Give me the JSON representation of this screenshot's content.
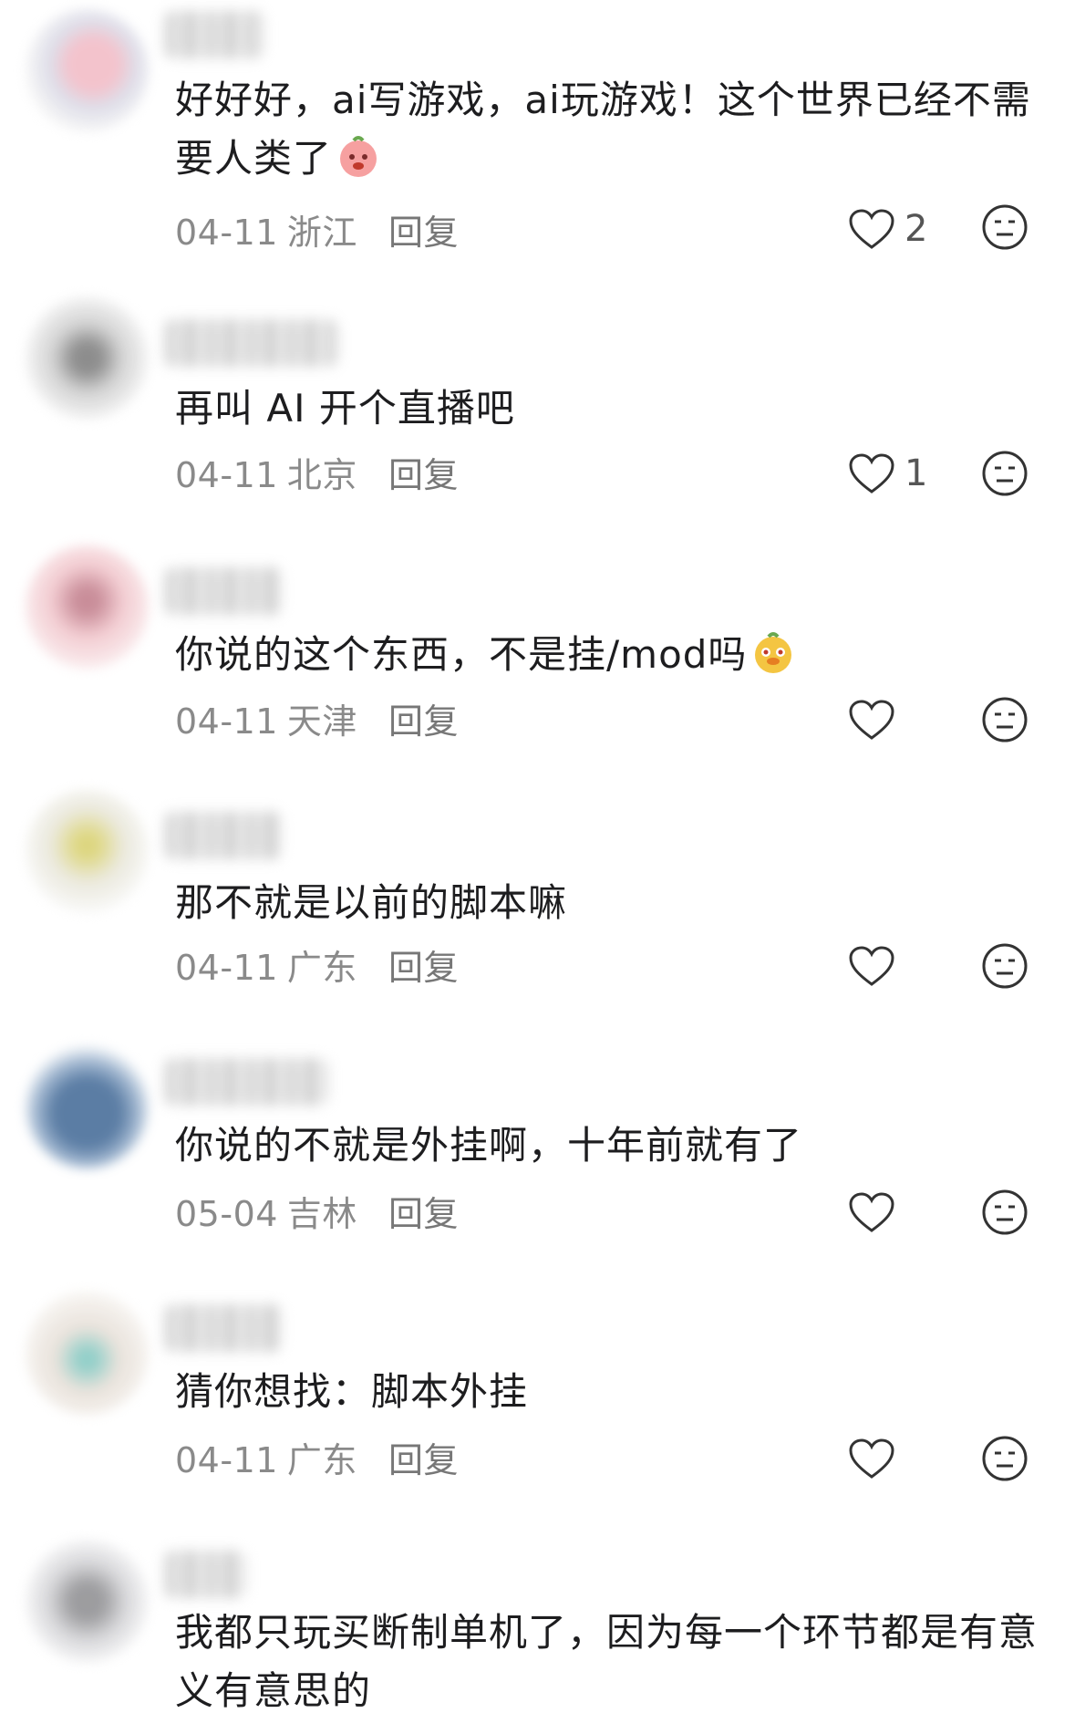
{
  "actions": {
    "reply_label": "回复"
  },
  "comments": [
    {
      "text": "好好好，ai写游戏，ai玩游戏！这个世界已经不需要人类了",
      "date": "04-11",
      "location": "浙江",
      "likes": "2",
      "emoji": "pink-blob-emoji",
      "avatar_color": "#e8c9cf"
    },
    {
      "text": "再叫 AI 开个直播吧",
      "date": "04-11",
      "location": "北京",
      "likes": "1",
      "avatar_color": "#bcbcbc"
    },
    {
      "text": "你说的这个东西，不是挂/mod吗",
      "date": "04-11",
      "location": "天津",
      "likes": "",
      "emoji": "yellow-dog-emoji",
      "avatar_color": "#f1c7cc"
    },
    {
      "text": "那不就是以前的脚本嘛",
      "date": "04-11",
      "location": "广东",
      "likes": "",
      "avatar_color": "#e6e4cf"
    },
    {
      "text": "你说的不就是外挂啊，十年前就有了",
      "date": "05-04",
      "location": "吉林",
      "likes": "",
      "avatar_color": "#5a7ea8"
    },
    {
      "text": "猜你想找：脚本外挂",
      "date": "04-11",
      "location": "广东",
      "likes": "",
      "avatar_color": "#e2dcd4"
    },
    {
      "text": "我都只玩买断制单机了，因为每一个环节都是有意义有意思的",
      "date": "",
      "location": "",
      "likes": "",
      "avatar_color": "#cfcfd1"
    }
  ]
}
